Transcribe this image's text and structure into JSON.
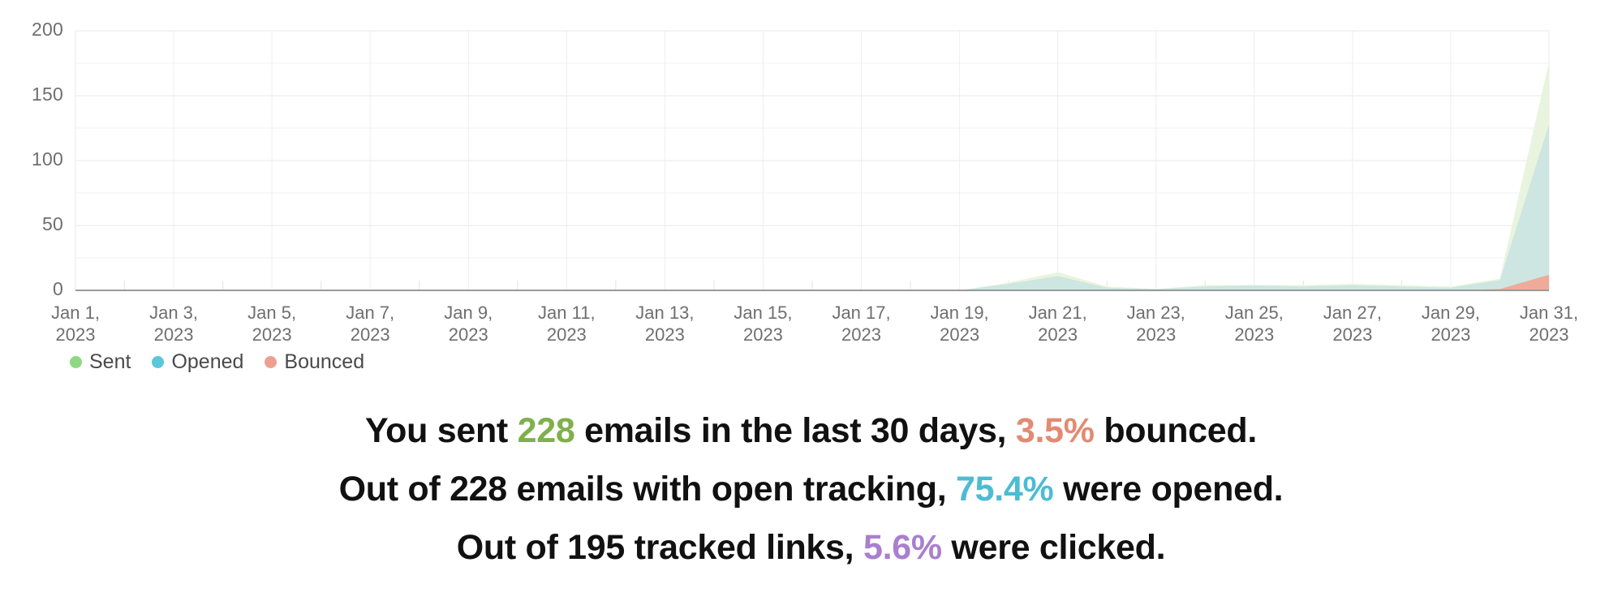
{
  "chart_data": {
    "type": "area",
    "title": "",
    "xlabel": "",
    "ylabel": "",
    "ylim": [
      0,
      200
    ],
    "yticks": [
      "0",
      "50",
      "100",
      "150",
      "200"
    ],
    "ytick_values": [
      0,
      50,
      100,
      150,
      200
    ],
    "grid": true,
    "legend_position": "bottom-left",
    "stacked": false,
    "x": [
      "Jan 1, 2023",
      "Jan 2, 2023",
      "Jan 3, 2023",
      "Jan 4, 2023",
      "Jan 5, 2023",
      "Jan 6, 2023",
      "Jan 7, 2023",
      "Jan 8, 2023",
      "Jan 9, 2023",
      "Jan 10, 2023",
      "Jan 11, 2023",
      "Jan 12, 2023",
      "Jan 13, 2023",
      "Jan 14, 2023",
      "Jan 15, 2023",
      "Jan 16, 2023",
      "Jan 17, 2023",
      "Jan 18, 2023",
      "Jan 19, 2023",
      "Jan 20, 2023",
      "Jan 21, 2023",
      "Jan 22, 2023",
      "Jan 23, 2023",
      "Jan 24, 2023",
      "Jan 25, 2023",
      "Jan 26, 2023",
      "Jan 27, 2023",
      "Jan 28, 2023",
      "Jan 29, 2023",
      "Jan 30, 2023",
      "Jan 31, 2023"
    ],
    "xtick_labels": [
      "Jan 1,\n2023",
      "Jan 3,\n2023",
      "Jan 5,\n2023",
      "Jan 7,\n2023",
      "Jan 9,\n2023",
      "Jan 11,\n2023",
      "Jan 13,\n2023",
      "Jan 15,\n2023",
      "Jan 17,\n2023",
      "Jan 19,\n2023",
      "Jan 21,\n2023",
      "Jan 23,\n2023",
      "Jan 25,\n2023",
      "Jan 27,\n2023",
      "Jan 29,\n2023",
      "Jan 31,\n2023"
    ],
    "xtick_indices": [
      0,
      2,
      4,
      6,
      8,
      10,
      12,
      14,
      16,
      18,
      20,
      22,
      24,
      26,
      28,
      30
    ],
    "series": [
      {
        "name": "Sent",
        "color": "#8ed884",
        "fill": "#e9f4de",
        "values": [
          0,
          0,
          0,
          0,
          0,
          0,
          0,
          0,
          0,
          0,
          0,
          0,
          0,
          0,
          0,
          0,
          0,
          0,
          0,
          6,
          14,
          3,
          1,
          4,
          4,
          4,
          5,
          4,
          3,
          9,
          176
        ]
      },
      {
        "name": "Opened",
        "color": "#5ac7da",
        "fill": "#cde6e2",
        "values": [
          0,
          0,
          0,
          0,
          0,
          0,
          0,
          0,
          0,
          0,
          0,
          0,
          0,
          0,
          0,
          0,
          0,
          0,
          0,
          5,
          11,
          2,
          1,
          3,
          4,
          3,
          4,
          3,
          2,
          8,
          128
        ]
      },
      {
        "name": "Bounced",
        "color": "#eda08f",
        "fill": "#eeab9a",
        "values": [
          0,
          0,
          0,
          0,
          0,
          0,
          0,
          0,
          0,
          0,
          0,
          0,
          0,
          0,
          0,
          0,
          0,
          0,
          0,
          0,
          0,
          0,
          0,
          0,
          0,
          0,
          0,
          0,
          0,
          1,
          12
        ]
      }
    ]
  },
  "legend": {
    "items": [
      {
        "label": "Sent",
        "color": "#8ed884"
      },
      {
        "label": "Opened",
        "color": "#5ac7da"
      },
      {
        "label": "Bounced",
        "color": "#eda08f"
      }
    ]
  },
  "summary": {
    "line1": {
      "part1": "You sent ",
      "value1": "228",
      "value1_color": "#7fb04a",
      "part2": " emails in the last 30 days, ",
      "value2": "3.5%",
      "value2_color": "#e38a72",
      "part3": " bounced."
    },
    "line2": {
      "part1": "Out of 228 emails with open tracking, ",
      "value1": "75.4%",
      "value1_color": "#4cbcd3",
      "part2": " were opened."
    },
    "line3": {
      "part1": "Out of 195 tracked links, ",
      "value1": "5.6%",
      "value1_color": "#a97fce",
      "part2": " were clicked."
    }
  }
}
